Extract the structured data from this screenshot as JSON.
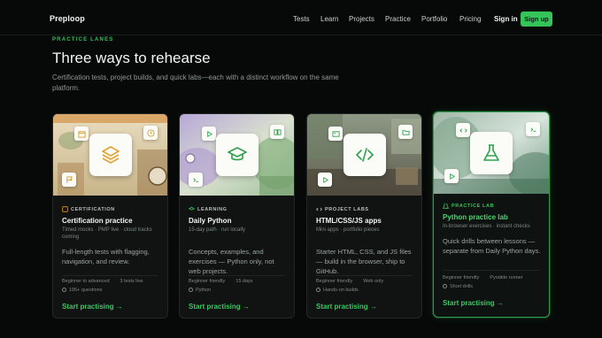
{
  "brand": "Preploop",
  "nav": {
    "links": [
      "Tests",
      "Learn",
      "Projects",
      "Practice",
      "Portfolio",
      "Pricing"
    ],
    "signin": "Sign in",
    "signup": "Sign up"
  },
  "header": {
    "eyebrow": "PRACTICE LANES",
    "title": "Three ways to rehearse",
    "subtitle": "Certification tests, project builds, and quick labs—each with a distinct workflow on the same platform."
  },
  "cards": [
    {
      "category": "CERTIFICATION",
      "title": "Certification practice",
      "meta": "Timed mocks · PMP live · cloud tracks coming",
      "description": "Full-length tests with flagging, navigation, and review.",
      "tags_row1": [
        "Beginner to advanced",
        "3 tests live"
      ],
      "tags_row2": "195+ questions",
      "cta": "Start practising →",
      "center_icon": "layers-icon"
    },
    {
      "category": "LEARNING",
      "title": "Daily Python",
      "meta": "15-day path · run locally",
      "description": "Concepts, examples, and exercises — Python only, not web projects.",
      "tags_row1": [
        "Beginner friendly",
        "15 days"
      ],
      "tags_row2": "Python",
      "cta": "Start practising →",
      "center_icon": "graduation-cap-icon"
    },
    {
      "category": "PROJECT LABS",
      "title": "HTML/CSS/JS apps",
      "meta": "Mini apps · portfolio pieces",
      "description": "Starter HTML, CSS, and JS files — build in the browser, ship to GitHub.",
      "tags_row1": [
        "Beginner friendly",
        "Web only"
      ],
      "tags_row2": "Hands-on builds",
      "cta": "Start practising →",
      "center_icon": "code-icon"
    },
    {
      "category": "PRACTICE LAB",
      "title": "Python practice lab",
      "meta": "In-browser exercises · instant checks",
      "description": "Quick drills between lessons — separate from Daily Python days.",
      "tags_row1": [
        "Beginner friendly",
        "Pyodide runner"
      ],
      "tags_row2": "Short drills",
      "cta": "Start practising →",
      "center_icon": "flask-icon"
    }
  ],
  "colors": {
    "accent": "#35c45a",
    "background": "#070908",
    "card": "#101312"
  }
}
